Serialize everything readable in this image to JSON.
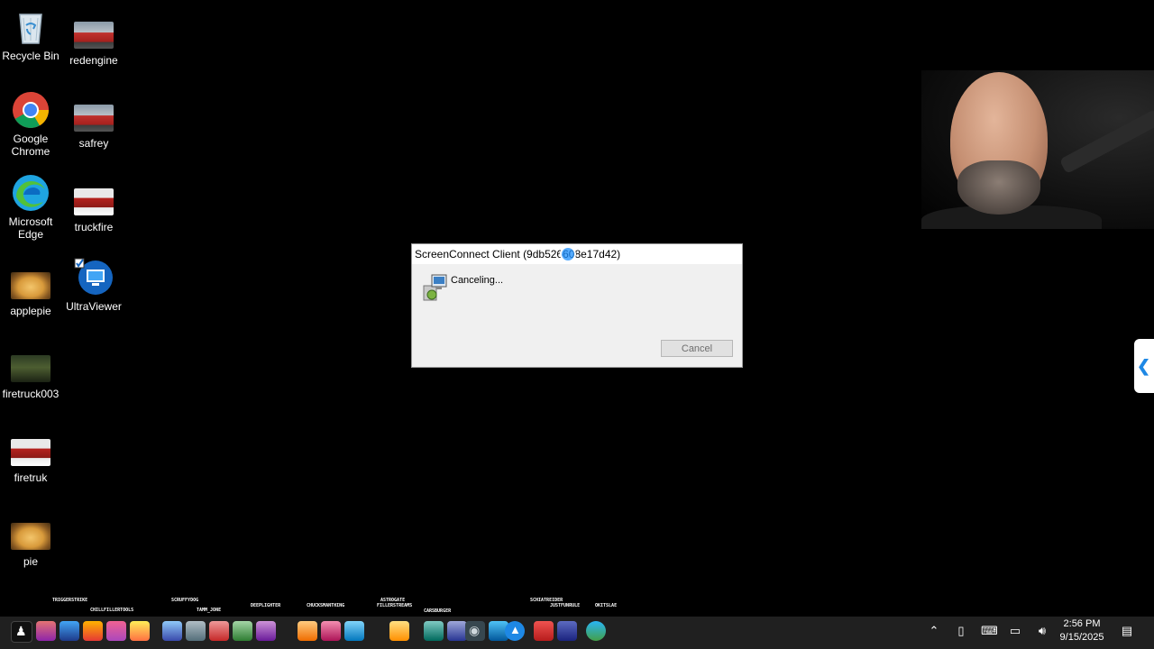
{
  "desktop": {
    "icons": [
      {
        "label": "Recycle Bin",
        "icon": "recycle-bin-icon"
      },
      {
        "label": "redengine",
        "icon": "fire-truck-thumbnail"
      },
      {
        "label": "Google Chrome",
        "icon": "chrome-icon"
      },
      {
        "label": "safrey",
        "icon": "fire-truck-thumbnail"
      },
      {
        "label": "Microsoft Edge",
        "icon": "edge-icon"
      },
      {
        "label": "truckfire",
        "icon": "fire-truck-thumbnail"
      },
      {
        "label": "applepie",
        "icon": "pie-thumbnail"
      },
      {
        "label": "UltraViewer",
        "icon": "ultraviewer-icon"
      },
      {
        "label": "firetruck003",
        "icon": "fire-truck-thumbnail"
      },
      {
        "label": "firetruk",
        "icon": "fire-truck-thumbnail"
      },
      {
        "label": "pie",
        "icon": "pie-thumbnail"
      }
    ]
  },
  "dialog": {
    "title": "ScreenConnect Client (9db52660",
    "title_suffix": "8e17d42)",
    "status": "Canceling...",
    "cancel_label": "Cancel"
  },
  "overlay": {
    "captions": [
      "TRIGGERSTRIKE",
      "CHILLFILLERTOOLS",
      "SCRUFFYDOG",
      "TAMM_JONE",
      "DEEPLIGHTER",
      "CHUCKSMANTHING",
      "ASTROGATE",
      "FILLERSTREAMS",
      "CARSBURGER",
      "SCHIATREIDER",
      "JUSTFUNRULE",
      "OKITSLAE"
    ]
  },
  "taskbar": {
    "time": "2:56 PM",
    "date": "9/15/2025"
  },
  "colors": {
    "desktop_bg": "#000000",
    "taskbar_bg": "#202020",
    "dialog_bg": "#f0f0f0",
    "accent": "#1e88e5"
  }
}
